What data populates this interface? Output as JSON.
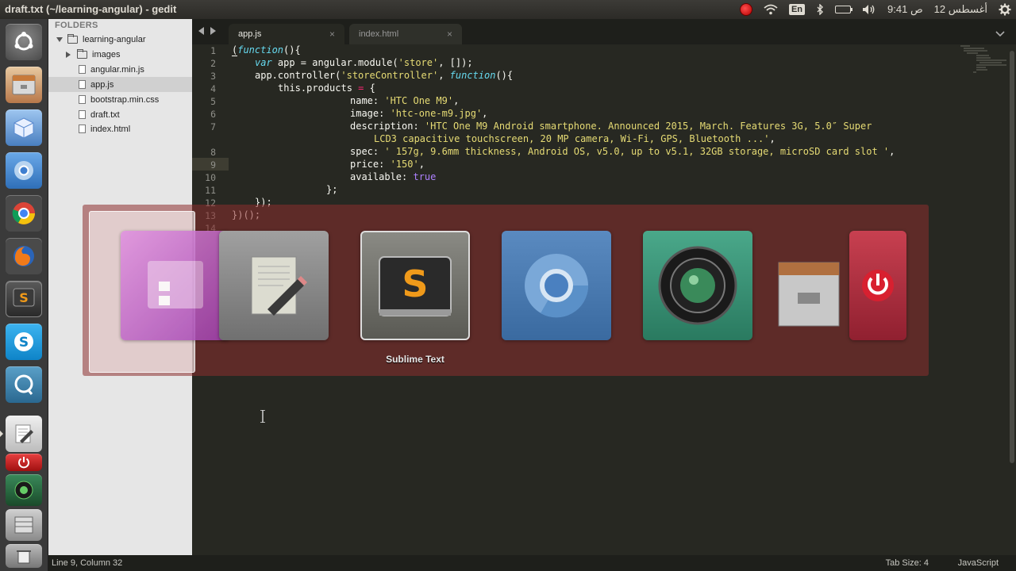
{
  "window": {
    "title": "draft.txt (~/learning-angular) - gedit"
  },
  "panel": {
    "keyboard_layout": "En",
    "clock": "9:41 ص",
    "date": "12 أغسطس"
  },
  "sidebar": {
    "header": "FOLDERS",
    "root": "learning-angular",
    "items": [
      {
        "label": "images",
        "type": "folder"
      },
      {
        "label": "angular.min.js",
        "type": "file"
      },
      {
        "label": "app.js",
        "type": "file"
      },
      {
        "label": "bootstrap.min.css",
        "type": "file"
      },
      {
        "label": "draft.txt",
        "type": "file"
      },
      {
        "label": "index.html",
        "type": "file"
      }
    ]
  },
  "tabs": [
    {
      "label": "app.js",
      "close": "×",
      "active": true
    },
    {
      "label": "index.html",
      "close": "×",
      "active": false
    }
  ],
  "editor": {
    "line_numbers": [
      "1",
      "2",
      "3",
      "4",
      "5",
      "6",
      "7",
      "",
      "8",
      "9",
      "10",
      "11",
      "12",
      "13",
      "14"
    ],
    "highlighted_line": "9",
    "code": {
      "l1_kw": "function",
      "l2_var": "var",
      "l2_rest": " app = angular.module(",
      "l2_str": "'store'",
      "l2_end": ", []);",
      "l3_a": "app.controller(",
      "l3_str": "'storeController'",
      "l3_kw": "function",
      "l4_a": "this.products ",
      "l4_op": "=",
      "l4_b": " {",
      "l5_key": "name: ",
      "l5_val": "'HTC One M9'",
      "l6_key": "image: ",
      "l6_val": "'htc-one-m9.jpg'",
      "l7_key": "description: ",
      "l7_val": "'HTC One M9 Android smartphone. Announced 2015, March. Features 3G, 5.0″ Super",
      "l7b_val": "LCD3 capacitive touchscreen, 20 MP camera, Wi-Fi, GPS, Bluetooth ...'",
      "l8_key": "spec: ",
      "l8_val": "' 157g, 9.6mm thickness, Android OS, v5.0, up to v5.1, 32GB storage, microSD card slot '",
      "l9_key": "price: ",
      "l9_val": "'150'",
      "l10_key": "available: ",
      "l10_val": "true",
      "l11": "};",
      "l12": "});",
      "l13": "})();"
    }
  },
  "statusbar": {
    "position": "Line 9, Column 32",
    "tab_size": "Tab Size: 4",
    "syntax": "JavaScript"
  },
  "switcher": {
    "selected_label": "Sublime Text",
    "apps": [
      "File Manager",
      "Text Editor",
      "Sublime Text",
      "Chromium",
      "Cheese",
      "Archive Manager",
      "Shutdown"
    ]
  }
}
